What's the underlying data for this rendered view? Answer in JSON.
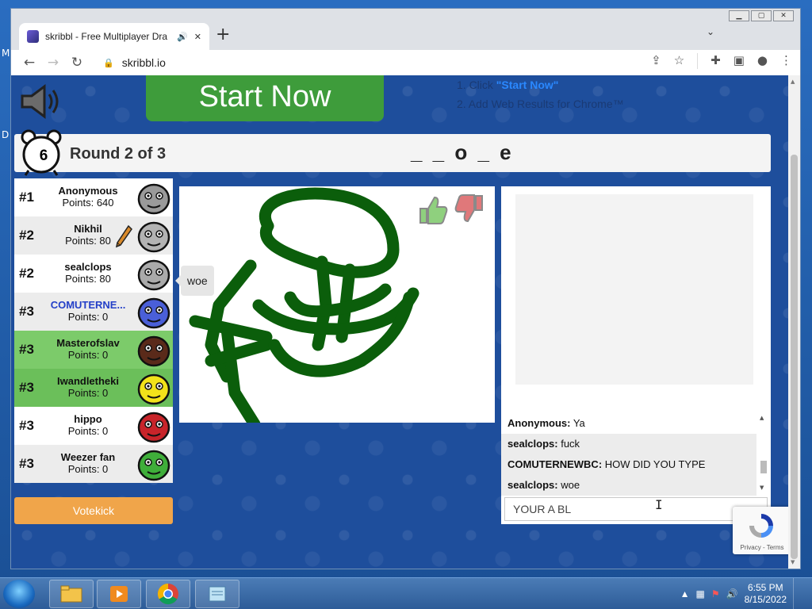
{
  "desktop": {
    "side_letters": [
      "M",
      "D"
    ]
  },
  "browser": {
    "tab_title": "skribbl - Free Multiplayer Dra",
    "new_tab": "+",
    "url": "skribbl.io",
    "window_controls": [
      "▁",
      "▢",
      "✕"
    ]
  },
  "game": {
    "start_now_label": "Start Now",
    "ad_step1_prefix": "1. Click ",
    "ad_step1_highlight": "\"Start Now\"",
    "ad_step2": "2. Add Web Results for Chrome™",
    "timer": "6",
    "round_text": "Round 2 of 3",
    "word_hint": "_ _ o _ e",
    "votekick_label": "Votekick",
    "speech_bubble": "woe",
    "players": [
      {
        "rank": "#1",
        "name": "Anonymous",
        "points": "Points: 640",
        "face_color": "#9a9a9a",
        "guessed": false,
        "drawing": false,
        "you": false
      },
      {
        "rank": "#2",
        "name": "Nikhil",
        "points": "Points: 80",
        "face_color": "#b3b3b3",
        "guessed": false,
        "drawing": true,
        "you": false
      },
      {
        "rank": "#2",
        "name": "sealclops",
        "points": "Points: 80",
        "face_color": "#aaaaaa",
        "guessed": false,
        "drawing": false,
        "you": false
      },
      {
        "rank": "#3",
        "name": "COMUTERNE...",
        "points": "Points: 0",
        "face_color": "#4a5fd8",
        "guessed": false,
        "drawing": false,
        "you": true
      },
      {
        "rank": "#3",
        "name": "Masterofslav",
        "points": "Points: 0",
        "face_color": "#5a2a1a",
        "guessed": true,
        "drawing": false,
        "you": false
      },
      {
        "rank": "#3",
        "name": "Iwandletheki",
        "points": "Points: 0",
        "face_color": "#f2e21a",
        "guessed": true,
        "drawing": false,
        "you": false
      },
      {
        "rank": "#3",
        "name": "hippo",
        "points": "Points: 0",
        "face_color": "#c8242a",
        "guessed": false,
        "drawing": false,
        "you": false
      },
      {
        "rank": "#3",
        "name": "Weezer fan",
        "points": "Points: 0",
        "face_color": "#3fae3a",
        "guessed": false,
        "drawing": false,
        "you": false
      }
    ],
    "chat": [
      {
        "user": "Anonymous:",
        "text": "Ya"
      },
      {
        "user": "sealclops:",
        "text": "fuck"
      },
      {
        "user": "COMUTERNEWBC:",
        "text": "HOW DID YOU TYPE"
      },
      {
        "user": "sealclops:",
        "text": "woe"
      }
    ],
    "chat_input_value": "YOUR A BL",
    "recaptcha_text": "Privacy - Terms",
    "drawing_color": "#0b5e0b",
    "accent_green": "#3e9c3b",
    "votekick_color": "#f0a54a"
  },
  "taskbar": {
    "time": "6:55 PM",
    "date": "8/15/2022"
  }
}
